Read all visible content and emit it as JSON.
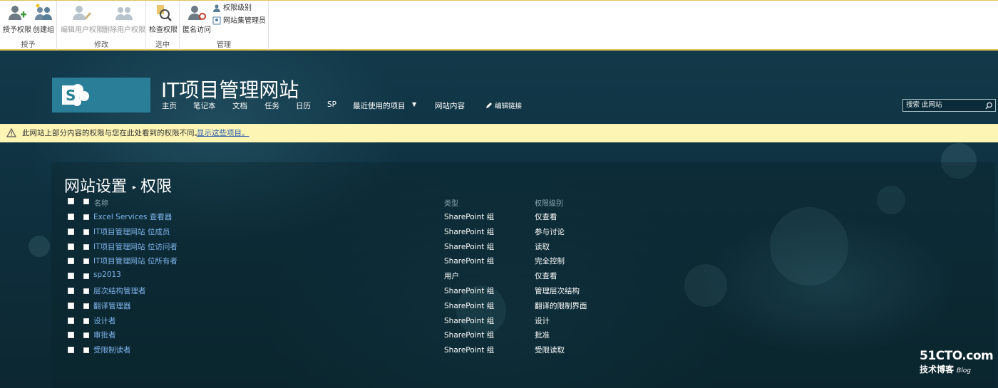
{
  "ribbon": {
    "groups": [
      {
        "label": "授予"
      },
      {
        "label": "修改"
      },
      {
        "label": "选中"
      },
      {
        "label": "管理"
      }
    ],
    "buttons": {
      "grant": "授予权限",
      "create_group": "创建组",
      "edit_user": "编辑用户权限",
      "remove_user": "删除用户权限",
      "check": "检查权限",
      "anonymous": "匿名访问",
      "levels": "权限级别",
      "site_admins": "网站集管理员"
    }
  },
  "header": {
    "site_title": "IT项目管理网站",
    "nav": [
      "主页",
      "笔记本",
      "文档",
      "任务",
      "日历",
      "SP",
      "最近使用的项目",
      "网站内容"
    ],
    "edit_links": "编辑链接",
    "search_placeholder": "搜索 此网站"
  },
  "notice": {
    "text": "此网站上部分内容的权限与您在此处看到的权限不同。",
    "link": "显示这些项目。"
  },
  "page": {
    "crumb1": "网站设置",
    "crumb2": "权限",
    "columns": {
      "name": "名称",
      "type": "类型",
      "level": "权限级别"
    },
    "rows": [
      {
        "name": "Excel Services 查看器",
        "type": "SharePoint 组",
        "level": "仅查看"
      },
      {
        "name": "IT项目管理网站 位成员",
        "type": "SharePoint 组",
        "level": "参与讨论"
      },
      {
        "name": "IT项目管理网站 位访问者",
        "type": "SharePoint 组",
        "level": "读取"
      },
      {
        "name": "IT项目管理网站 位所有者",
        "type": "SharePoint 组",
        "level": "完全控制"
      },
      {
        "name": "sp2013",
        "type": "用户",
        "level": "仅查看"
      },
      {
        "name": "层次结构管理者",
        "type": "SharePoint 组",
        "level": "管理层次结构"
      },
      {
        "name": "翻译管理器",
        "type": "SharePoint 组",
        "level": "翻译的限制界面"
      },
      {
        "name": "设计者",
        "type": "SharePoint 组",
        "level": "设计"
      },
      {
        "name": "审批者",
        "type": "SharePoint 组",
        "level": "批准"
      },
      {
        "name": "受限制读者",
        "type": "SharePoint 组",
        "level": "受限读取"
      }
    ]
  },
  "watermark": {
    "line1": "51CTO.com",
    "line2": "技术博客",
    "line3": "Blog"
  },
  "colors": {
    "accent": "#2b7e98",
    "link": "#7fb3ea",
    "notice_bg": "#fdf5b4"
  }
}
